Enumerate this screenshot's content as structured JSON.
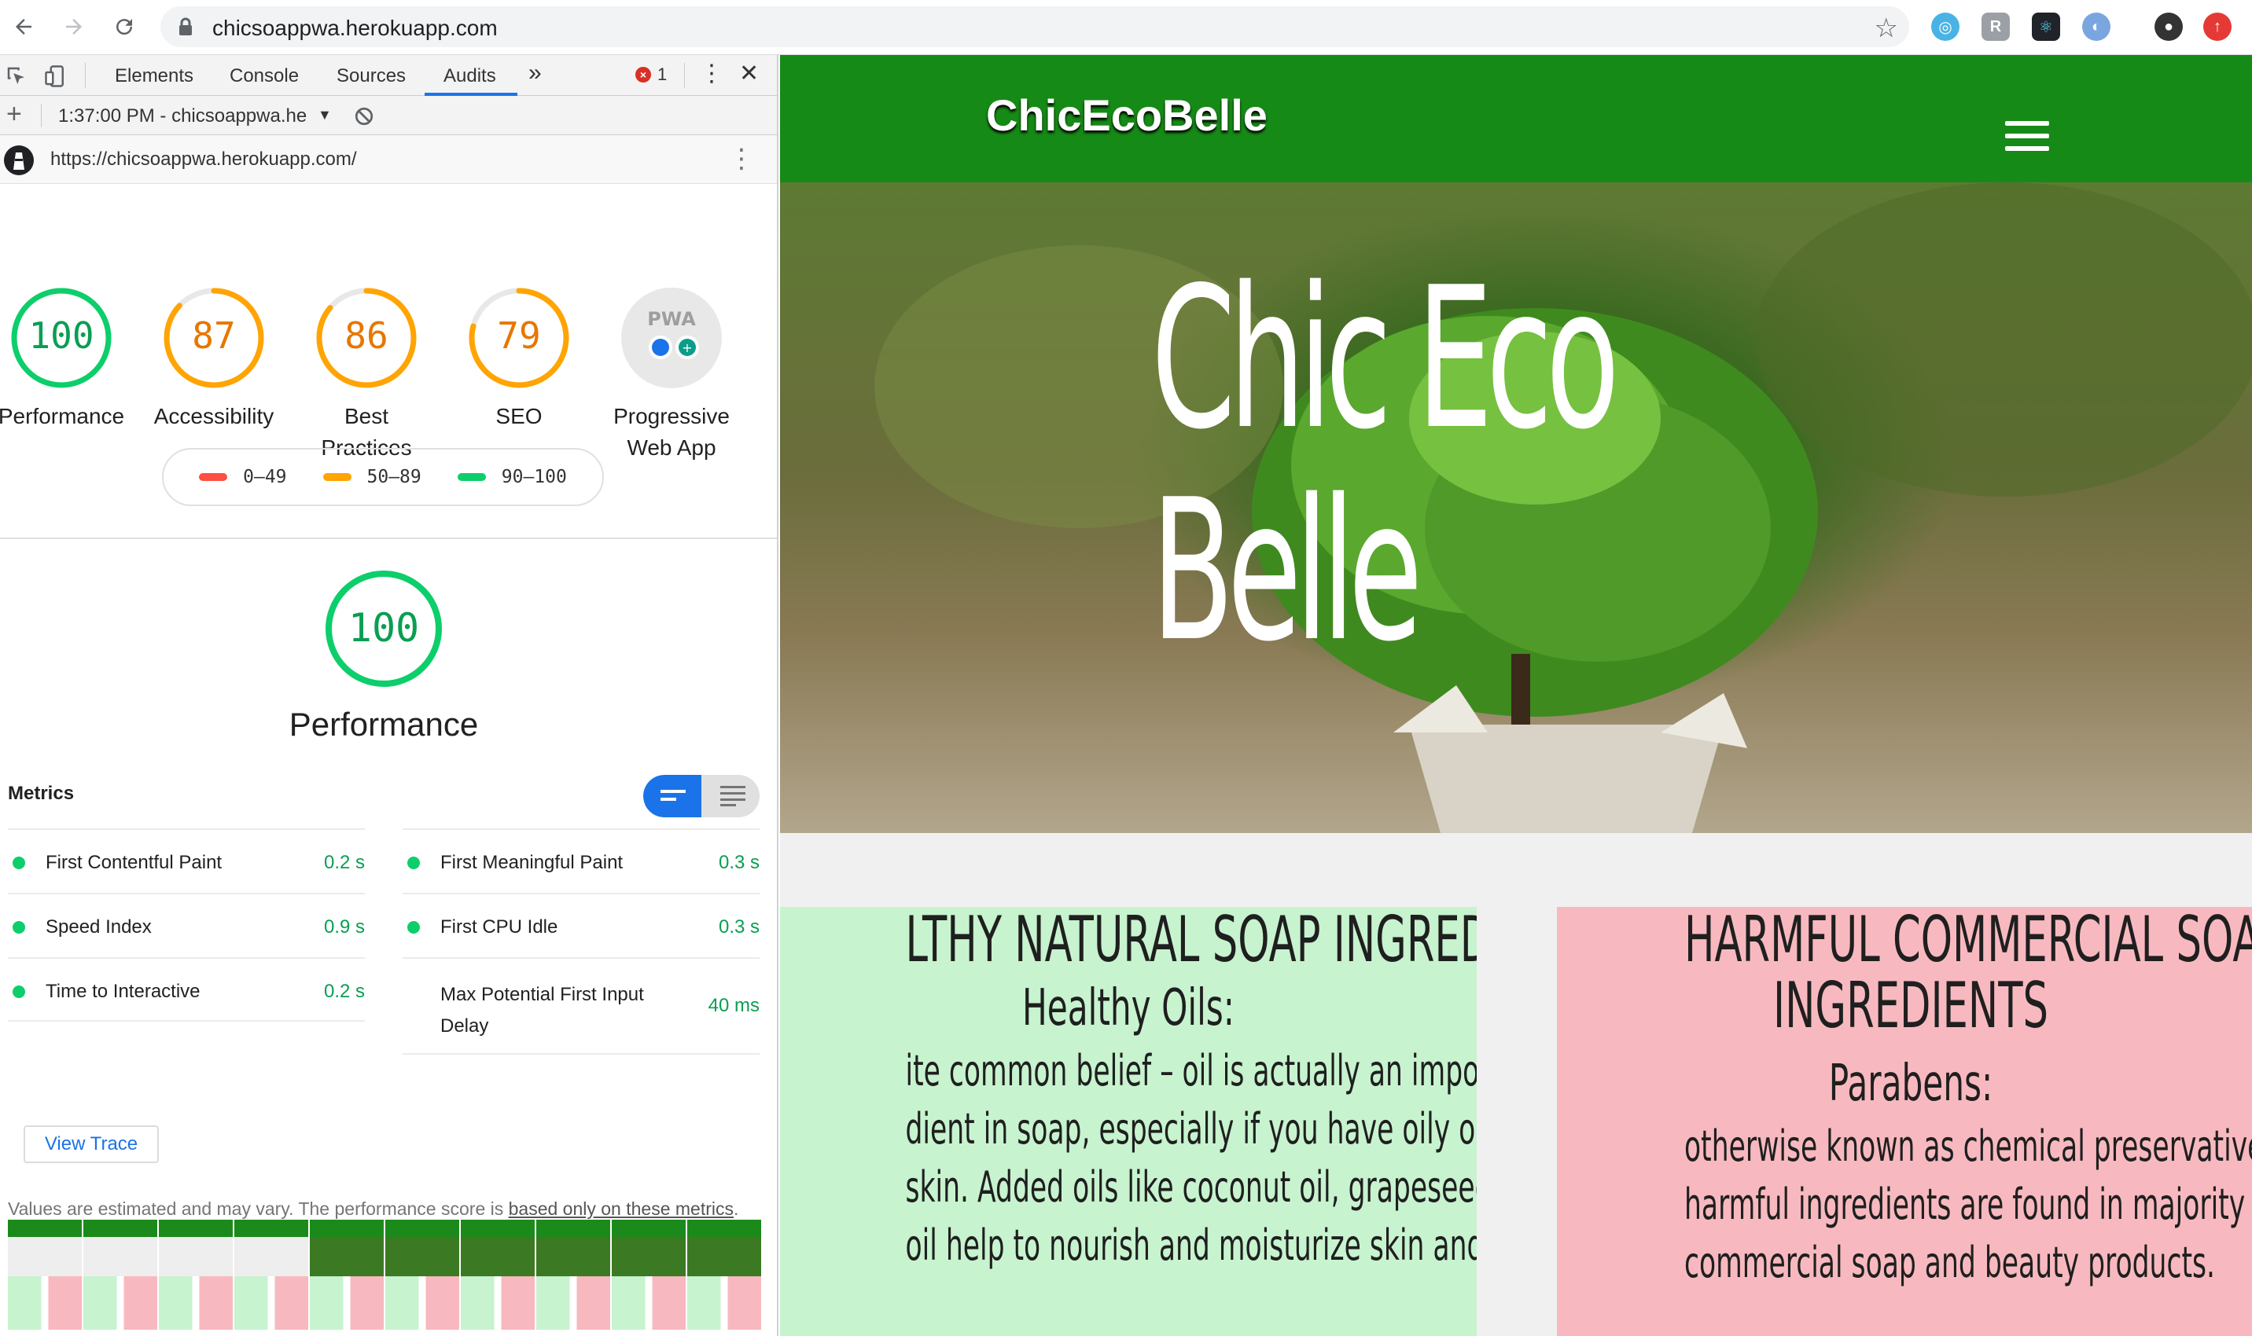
{
  "browser": {
    "url": "chicsoappwa.herokuapp.com"
  },
  "devtools": {
    "tabs": [
      "Elements",
      "Console",
      "Sources",
      "Audits"
    ],
    "active_tab": "Audits",
    "more_tabs": "»",
    "error_count": "1",
    "run_label": "1:37:00 PM - chicsoappwa.he",
    "audit_url": "https://chicsoappwa.herokuapp.com/"
  },
  "lighthouse": {
    "gauges": [
      {
        "label": "Performance",
        "score": "100",
        "color": "#0cce6b",
        "fraction": 1.0
      },
      {
        "label": "Accessibility",
        "score": "87",
        "color": "#ffa400",
        "fraction": 0.87
      },
      {
        "label": "Best Practices",
        "score": "86",
        "color": "#ffa400",
        "fraction": 0.86
      },
      {
        "label": "SEO",
        "score": "79",
        "color": "#ffa400",
        "fraction": 0.79
      },
      {
        "label": "Progressive Web App",
        "score": "",
        "color": "#9e9e9e",
        "fraction": 0
      }
    ],
    "pwa_badge": "PWA",
    "legend": [
      {
        "range": "0–49",
        "color": "#ff4e42"
      },
      {
        "range": "50–89",
        "color": "#ffa400"
      },
      {
        "range": "90–100",
        "color": "#0cce6b"
      }
    ],
    "category_title": "Performance",
    "category_score": "100",
    "metrics_heading": "Metrics",
    "metrics_left": [
      {
        "name": "First Contentful Paint",
        "value": "0.2 s"
      },
      {
        "name": "Speed Index",
        "value": "0.9 s"
      },
      {
        "name": "Time to Interactive",
        "value": "0.2 s"
      }
    ],
    "metrics_right": [
      {
        "name": "First Meaningful Paint",
        "value": "0.3 s"
      },
      {
        "name": "First CPU Idle",
        "value": "0.3 s"
      },
      {
        "name": "Max Potential First Input Delay",
        "value": "40 ms"
      }
    ],
    "view_trace": "View Trace",
    "note_prefix": "Values are estimated and may vary. The performance score is ",
    "note_link": "based only on these metrics",
    "note_suffix": "."
  },
  "site": {
    "brand": "ChicEcoBelle",
    "hero_line1": "Chic Eco",
    "hero_line2": "Belle",
    "healthy": {
      "heading": "LTHY NATURAL SOAP INGREDIENTS",
      "subheading": "Healthy Oils:",
      "lines": [
        "ite common belief – oil is actually an important",
        "dient in soap, especially if you have oily or acne",
        "skin. Added oils like coconut oil, grapeseed oil or",
        "oil help to nourish and moisturize skin and bring"
      ]
    },
    "harmful": {
      "heading_line1": "HARMFUL COMMERCIAL SOAP",
      "heading_line2": "INGREDIENTS",
      "subheading": "Parabens:",
      "lines": [
        "otherwise known as chemical preservatives, th",
        "harmful ingredients are found in majority o",
        "commercial soap and beauty products."
      ]
    }
  },
  "colors": {
    "site_green": "#168a16",
    "healthy_bg": "#c7f3cf",
    "harmful_bg": "#f7b9bf",
    "devtools_accent": "#1a73e8"
  }
}
